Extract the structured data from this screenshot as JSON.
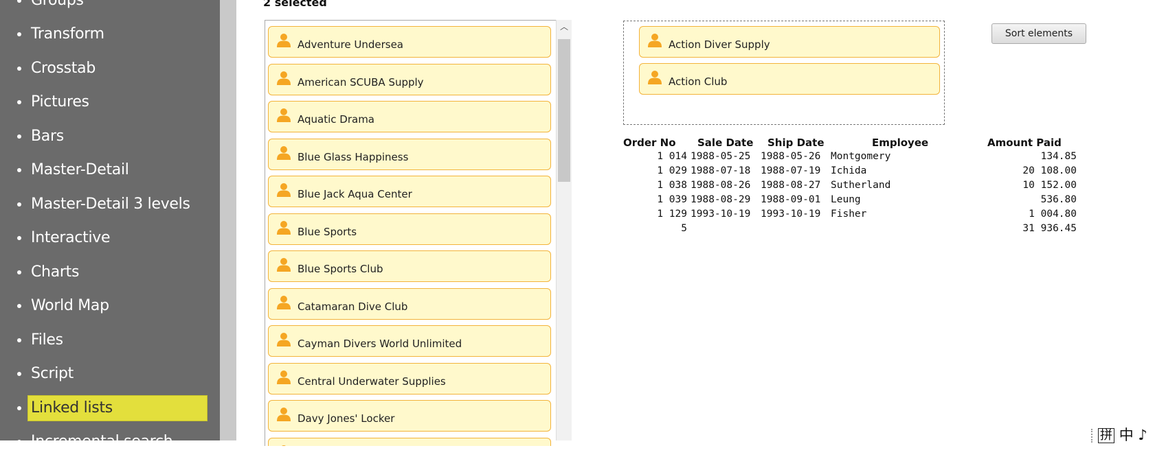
{
  "sidebar": {
    "items": [
      {
        "label": "Groups",
        "active": false
      },
      {
        "label": "Transform",
        "active": false
      },
      {
        "label": "Crosstab",
        "active": false
      },
      {
        "label": "Pictures",
        "active": false
      },
      {
        "label": "Bars",
        "active": false
      },
      {
        "label": "Master-Detail",
        "active": false
      },
      {
        "label": "Master-Detail 3 levels",
        "active": false
      },
      {
        "label": "Interactive",
        "active": false
      },
      {
        "label": "Charts",
        "active": false
      },
      {
        "label": "World Map",
        "active": false
      },
      {
        "label": "Files",
        "active": false
      },
      {
        "label": "Script",
        "active": false
      },
      {
        "label": "Linked lists",
        "active": true
      },
      {
        "label": "Incremental search",
        "active": false
      }
    ]
  },
  "selection": {
    "count_label": "2 selected"
  },
  "customers": [
    "Adventure Undersea",
    "American SCUBA Supply",
    "Aquatic Drama",
    "Blue Glass Happiness",
    "Blue Jack Aqua Center",
    "Blue Sports",
    "Blue Sports Club",
    "Catamaran Dive Club",
    "Cayman Divers World Unlimited",
    "Central Underwater Supplies",
    "Davy Jones' Locker",
    ""
  ],
  "selected_customers": [
    "Action Diver Supply",
    "Action Club"
  ],
  "sort_button_label": "Sort elements",
  "orders": {
    "headers": {
      "order_no": "Order No",
      "sale_date": "Sale Date",
      "ship_date": "Ship Date",
      "employee": "Employee",
      "amount_paid": "Amount Paid"
    },
    "rows": [
      {
        "order_no": "1 014",
        "sale_date": "1988-05-25",
        "ship_date": "1988-05-26",
        "employee": "Montgomery",
        "amount_paid": "134.85"
      },
      {
        "order_no": "1 029",
        "sale_date": "1988-07-18",
        "ship_date": "1988-07-19",
        "employee": "Ichida",
        "amount_paid": "20 108.00"
      },
      {
        "order_no": "1 038",
        "sale_date": "1988-08-26",
        "ship_date": "1988-08-27",
        "employee": "Sutherland",
        "amount_paid": "10 152.00"
      },
      {
        "order_no": "1 039",
        "sale_date": "1988-08-29",
        "ship_date": "1988-09-01",
        "employee": "Leung",
        "amount_paid": "536.80"
      },
      {
        "order_no": "1 129",
        "sale_date": "1993-10-19",
        "ship_date": "1993-10-19",
        "employee": "Fisher",
        "amount_paid": "1 004.80"
      }
    ],
    "total_count": "5",
    "total_amount": "31 936.45"
  },
  "ime": {
    "pinyin": "拼",
    "lang": "中",
    "punct": "♪"
  },
  "colors": {
    "sidebar_bg": "#6b6b6b",
    "active_item": "#e3df3c",
    "card_bg": "#fff9cc",
    "card_border": "#f3b33a",
    "person_icon": "#f5a623"
  }
}
